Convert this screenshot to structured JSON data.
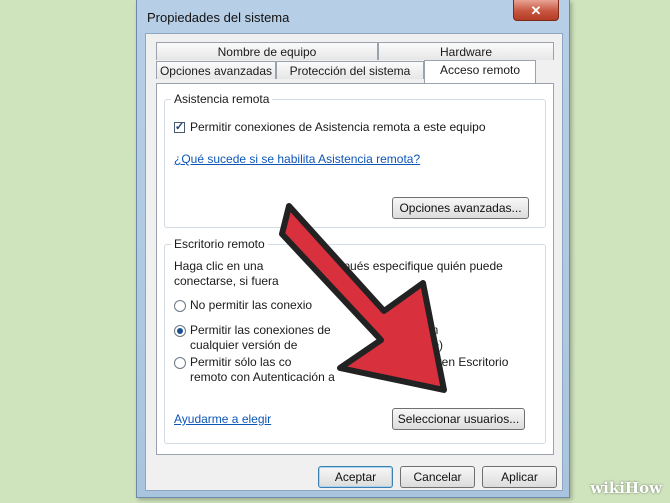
{
  "window": {
    "title": "Propiedades del sistema",
    "close_glyph": "✕"
  },
  "tabs": {
    "row1": [
      "Nombre de equipo",
      "Hardware"
    ],
    "row2": [
      "Opciones avanzadas",
      "Protección del sistema",
      "Acceso remoto"
    ],
    "active": "Acceso remoto"
  },
  "remote_assistance": {
    "legend": "Asistencia remota",
    "checkbox_label": "Permitir conexiones de Asistencia remota a este equipo",
    "checkbox_checked": true,
    "help_link": "¿Qué sucede si se habilita Asistencia remota?",
    "advanced_button": "Opciones avanzadas..."
  },
  "remote_desktop": {
    "legend": "Escritorio remoto",
    "description_line1_a": "Haga clic en una",
    "description_line1_b": "después especifique quién puede",
    "description_line2": "conectarse, si fuera",
    "options": [
      {
        "line1": "No permitir las conexio",
        "line2": "",
        "selected": false
      },
      {
        "line1": "Permitir las conexiones de",
        "line1_b": "cuten",
        "line2": "cualquier versión de",
        "line2_b": "guro)",
        "selected": true
      },
      {
        "line1": "Permitir sólo las co",
        "line1_b": "ecuten Escritorio",
        "line2": "remoto con Autenticación a",
        "line2_b": "",
        "selected": false
      }
    ],
    "help_link": "Ayudarme a elegir",
    "select_users_button": "Seleccionar usuarios..."
  },
  "footer": {
    "ok": "Aceptar",
    "cancel": "Cancelar",
    "apply": "Aplicar"
  },
  "overlay": {
    "arrow_color": "#d8303c",
    "watermark": "wikiHow"
  }
}
